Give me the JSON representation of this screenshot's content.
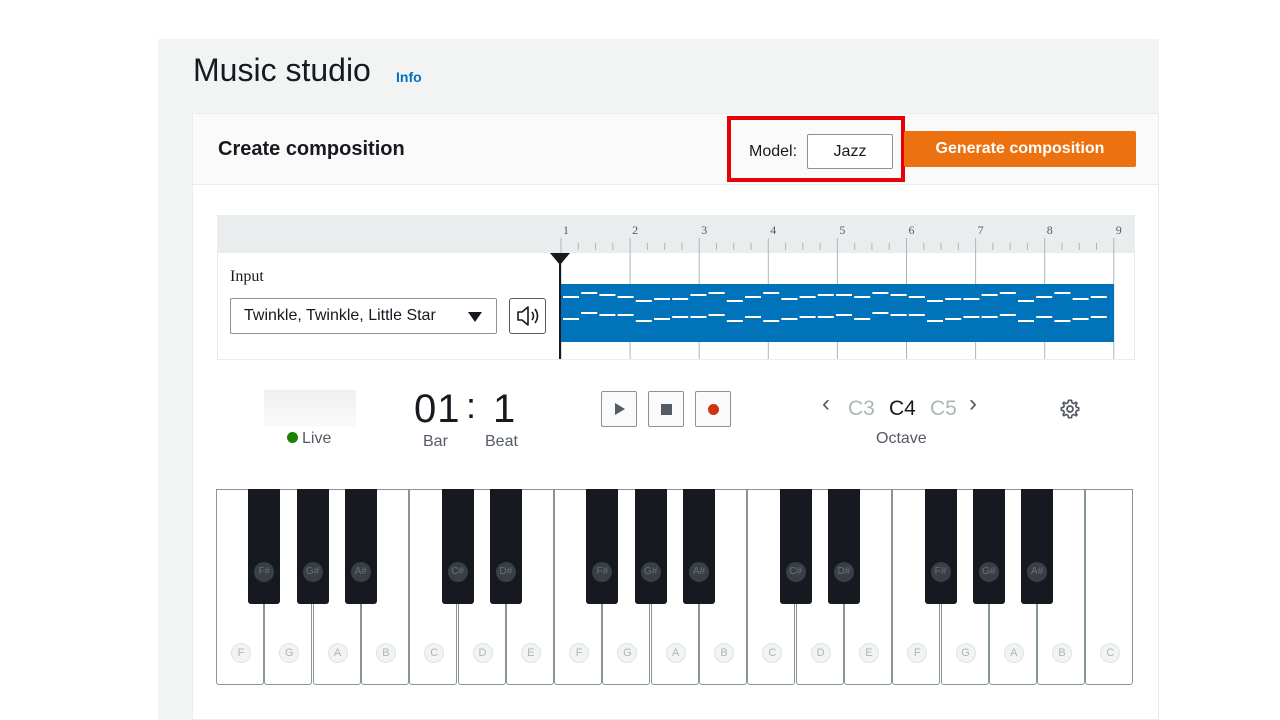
{
  "header": {
    "title": "Music studio",
    "info_link": "Info"
  },
  "panel": {
    "title": "Create composition",
    "model_label": "Model:",
    "model_value": "Jazz",
    "generate_button": "Generate composition"
  },
  "timeline": {
    "bar_numbers": [
      "1",
      "2",
      "3",
      "4",
      "5",
      "6",
      "7",
      "8",
      "9"
    ],
    "track_color": "#0073bb",
    "input_label": "Input",
    "input_value": "Twinkle, Twinkle, Little Star"
  },
  "transport": {
    "live_label": "Live",
    "bar_value": "01",
    "separator": ":",
    "beat_value": "1",
    "bar_label": "Bar",
    "beat_label": "Beat",
    "play_icon": "play-icon",
    "stop_icon": "stop-icon",
    "record_icon": "record-icon"
  },
  "octave": {
    "prev": "C3",
    "current": "C4",
    "next": "C5",
    "label": "Octave"
  },
  "keyboard": {
    "white_keys": [
      "F",
      "G",
      "A",
      "B",
      "C",
      "D",
      "E",
      "F",
      "G",
      "A",
      "B",
      "C",
      "D",
      "E",
      "F",
      "G",
      "A",
      "B",
      "C"
    ],
    "black_keys": [
      "F#",
      "G#",
      "A#",
      "C#",
      "D#",
      "F#",
      "G#",
      "A#",
      "C#",
      "D#",
      "F#",
      "G#",
      "A#"
    ]
  },
  "colors": {
    "accent": "#ec7211",
    "highlight_box": "#e8000b",
    "live": "#1d8102",
    "record": "#d13212"
  }
}
